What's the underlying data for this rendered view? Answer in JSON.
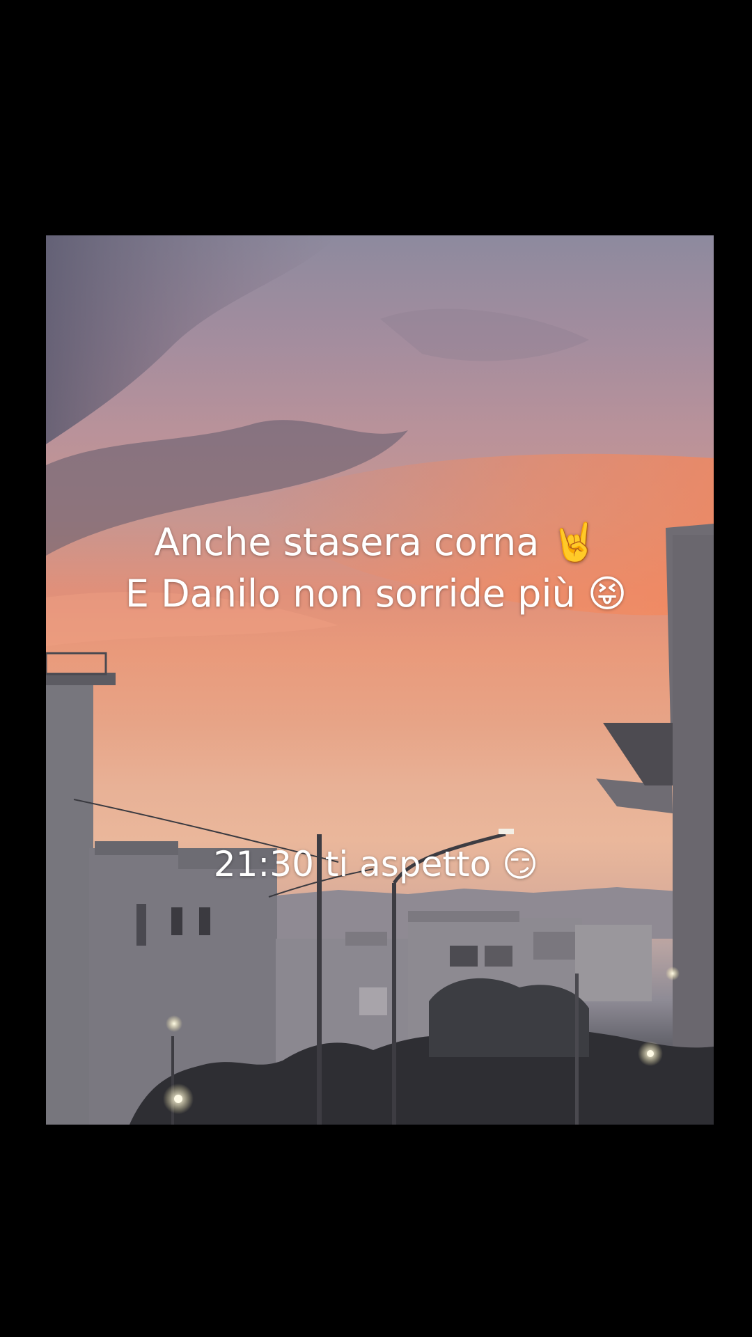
{
  "captions": {
    "line1": "Anche stasera corna 🤘",
    "line2": "E Danilo non sorride più 😝",
    "line3": "21:30 ti aspetto 😏"
  },
  "photo": {
    "subject": "sunset sky over city buildings with street lamps",
    "colors": {
      "sky_top": "#8d8a9e",
      "sky_orange": "#e99a7b",
      "sky_horizon": "#eab79b",
      "buildings": "#6e6b72"
    }
  }
}
